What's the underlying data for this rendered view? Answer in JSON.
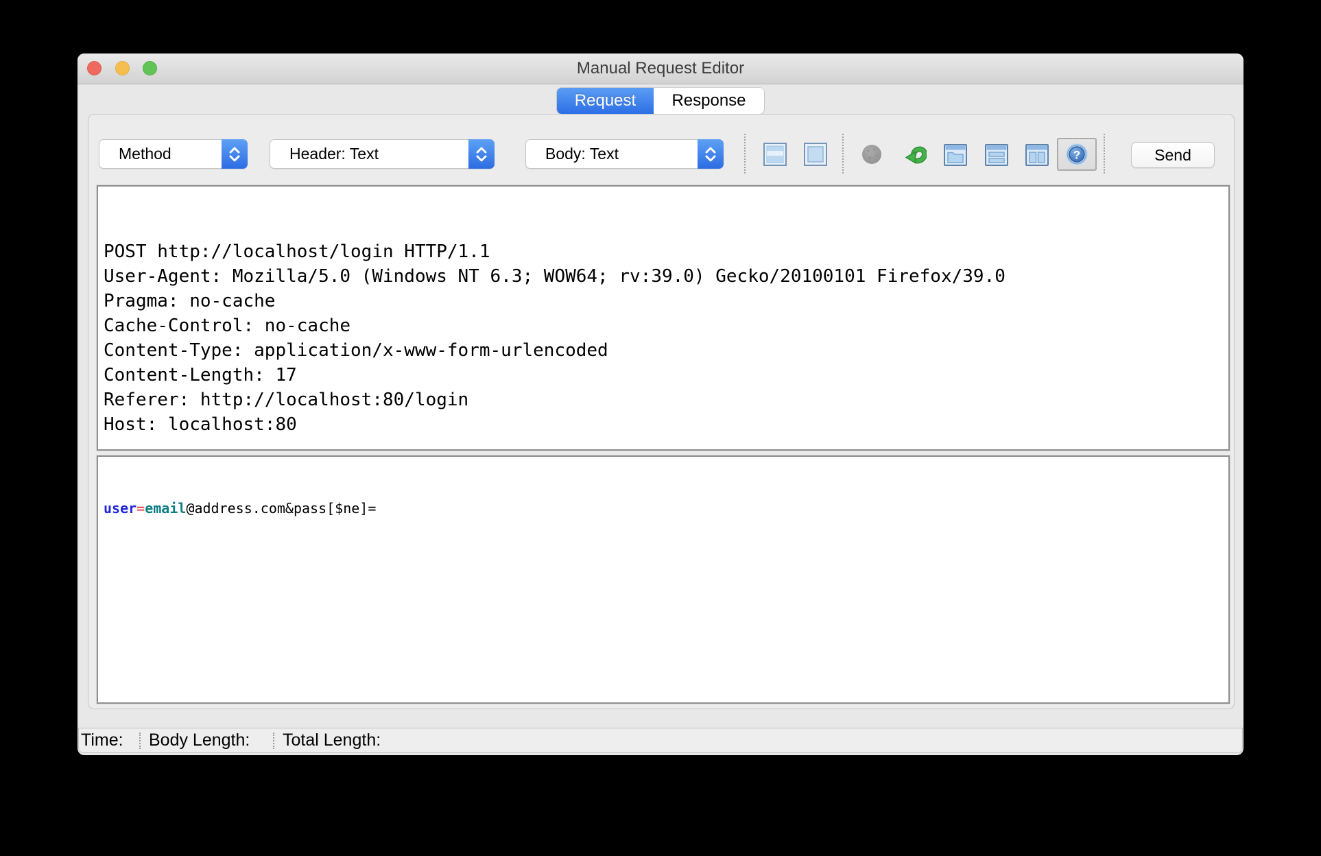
{
  "window": {
    "title": "Manual Request Editor"
  },
  "tabs": {
    "request": "Request",
    "response": "Response"
  },
  "toolbar": {
    "method_label": "Method",
    "header_label": "Header: Text",
    "body_label": "Body: Text",
    "send_label": "Send",
    "icons": [
      "pane-combined-icon",
      "pane-single-icon",
      "record-icon",
      "resend-icon",
      "tab-view-icon",
      "split-horizontal-icon",
      "split-vertical-icon",
      "help-icon"
    ]
  },
  "request_editor": {
    "header_lines": [
      "POST http://localhost/login HTTP/1.1",
      "User-Agent: Mozilla/5.0 (Windows NT 6.3; WOW64; rv:39.0) Gecko/20100101 Firefox/39.0",
      "Pragma: no-cache",
      "Cache-Control: no-cache",
      "Content-Type: application/x-www-form-urlencoded",
      "Content-Length: 17",
      "Referer: http://localhost:80/login",
      "Host: localhost:80"
    ],
    "body_segments": [
      {
        "text": "user",
        "color": "#2026d8",
        "bold": true
      },
      {
        "text": "=",
        "color": "#e62e2e",
        "bold": false
      },
      {
        "text": "email",
        "color": "#0d7e82",
        "bold": true
      },
      {
        "text": "@address.com&pass[$ne]=",
        "color": "#000000",
        "bold": false
      }
    ]
  },
  "status_bar": {
    "time_label": "Time:",
    "body_length_label": "Body Length:",
    "total_length_label": "Total Length:"
  },
  "colors": {
    "traffic_red": "#ee6a5f",
    "traffic_yellow": "#f5bf4f",
    "traffic_green": "#61c555",
    "tab_selected_top": "#5b9df3",
    "tab_selected_bottom": "#2d6fe6",
    "icon_blue_fill": "#bcd8f0",
    "icon_blue_border": "#7494b8",
    "resend_green": "#45b14b",
    "record_gray": "#9d9d9d"
  }
}
